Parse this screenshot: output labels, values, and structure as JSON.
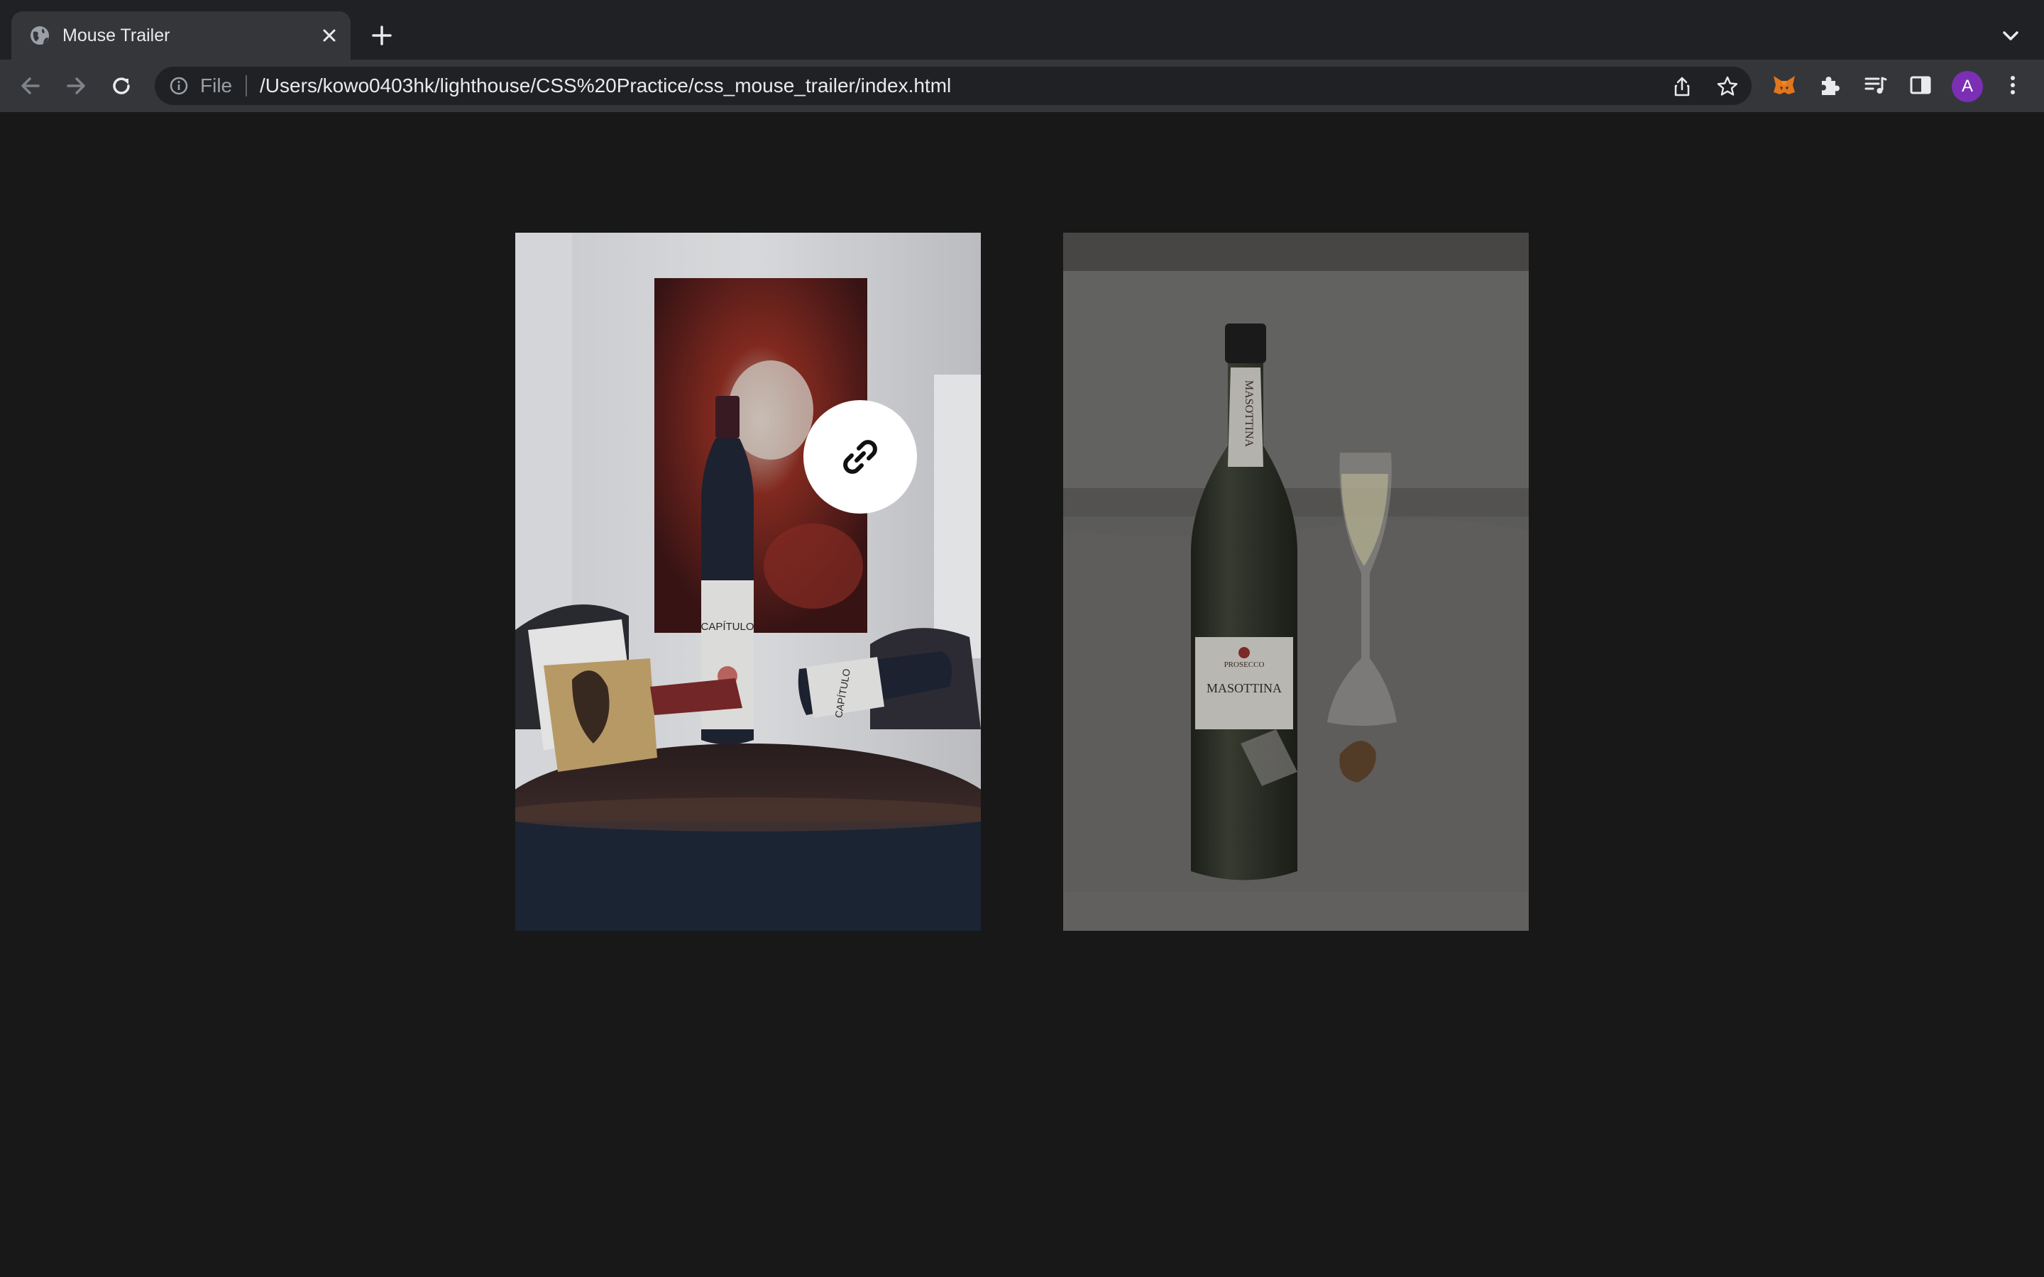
{
  "browser": {
    "tab": {
      "title": "Mouse Trailer"
    },
    "address": {
      "scheme": "File",
      "url": "/Users/kowo0403hk/lighthouse/CSS%20Practice/css_mouse_trailer/index.html"
    },
    "profile_initial": "A"
  },
  "page": {
    "images": [
      {
        "bottle_label": "CAPÍTULO",
        "lying_bottle_label": "CAPÍTULO"
      },
      {
        "brand_label": "MASOTTINA",
        "neck_label": "MASOTTINA",
        "sub_label": "PROSECCO"
      }
    ],
    "cursor_trailer": {
      "icon": "link-icon"
    }
  }
}
